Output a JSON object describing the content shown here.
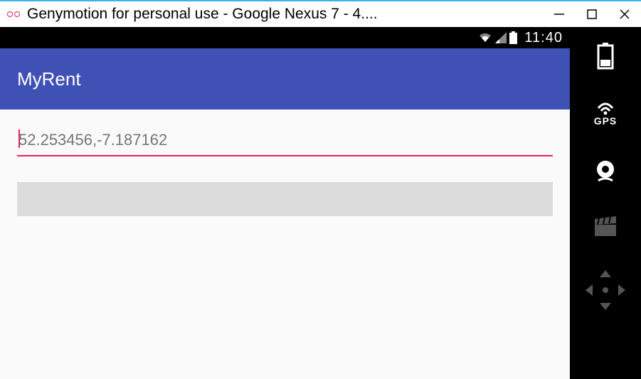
{
  "window": {
    "title": "Genymotion for personal use - Google Nexus 7 - 4...."
  },
  "statusbar": {
    "time": "11:40"
  },
  "app": {
    "title": "MyRent",
    "coordinates_hint": "52.253456,-7.187162"
  },
  "toolbar": {
    "gps_label": "GPS"
  }
}
